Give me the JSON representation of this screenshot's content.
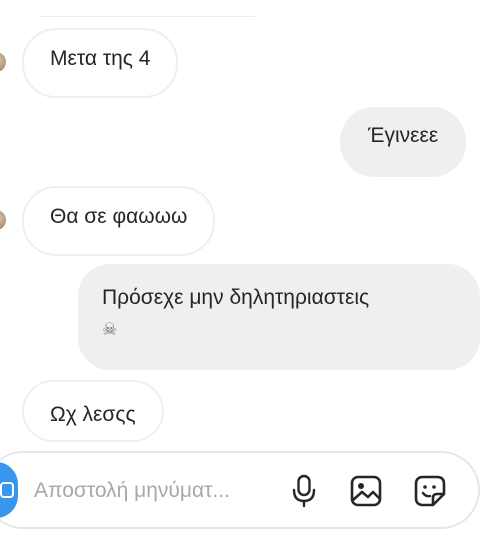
{
  "messages": [
    {
      "side": "incoming",
      "text": "Μετα της 4"
    },
    {
      "side": "outgoing",
      "text": "Έγινεεε"
    },
    {
      "side": "incoming",
      "text": "Θα σε φαωωω"
    },
    {
      "side": "outgoing",
      "text": "Πρόσεχε μην δηλητηριαστεις",
      "emoji": "☠"
    },
    {
      "side": "incoming",
      "text": "Ωχ λεσςς"
    }
  ],
  "composer": {
    "placeholder": "Αποστολή μηνύματ...",
    "icons": [
      "camera-icon",
      "microphone-icon",
      "gallery-icon",
      "sticker-icon"
    ]
  },
  "colors": {
    "incoming_border": "#efefef",
    "outgoing_bg": "#efefef",
    "accent": "#3797f0",
    "text": "#262626",
    "placeholder": "#a8a8a8"
  }
}
